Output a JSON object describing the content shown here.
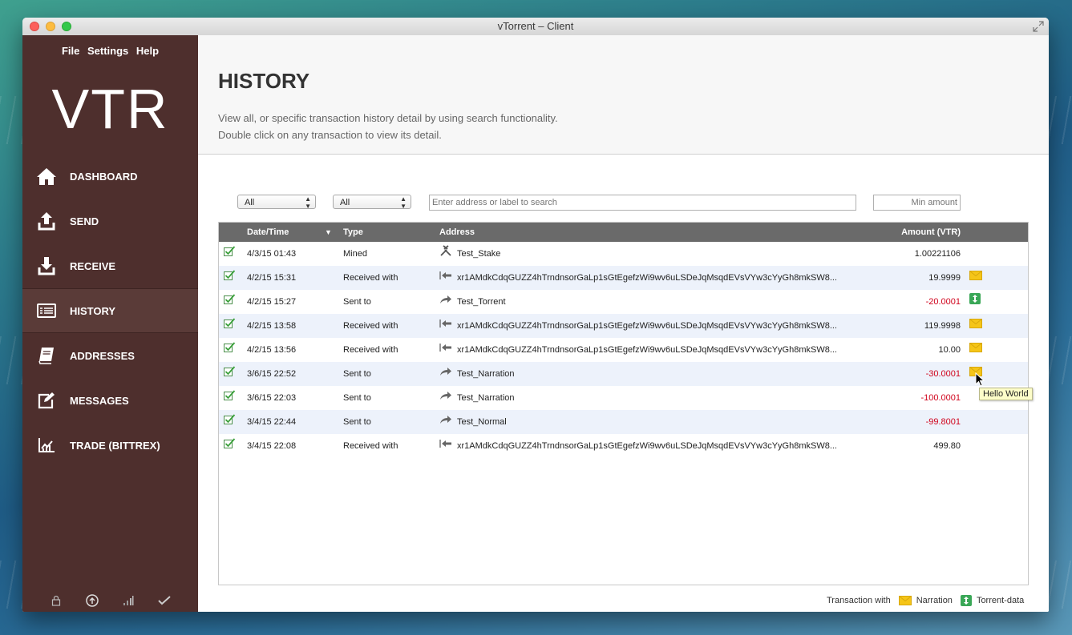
{
  "window": {
    "title": "vTorrent – Client"
  },
  "sidebar": {
    "menu": [
      "File",
      "Settings",
      "Help"
    ],
    "logo": "VTR",
    "nav": [
      {
        "label": "DASHBOARD",
        "icon": "home-icon"
      },
      {
        "label": "SEND",
        "icon": "upload-icon"
      },
      {
        "label": "RECEIVE",
        "icon": "download-icon"
      },
      {
        "label": "HISTORY",
        "icon": "list-icon",
        "active": true
      },
      {
        "label": "ADDRESSES",
        "icon": "book-icon"
      },
      {
        "label": "MESSAGES",
        "icon": "compose-icon"
      },
      {
        "label": "TRADE (BITTREX)",
        "icon": "chart-icon"
      }
    ],
    "footer_icons": [
      "lock-icon",
      "arrow-up-circle-icon",
      "signal-bars-icon",
      "checkmark-icon"
    ]
  },
  "header": {
    "title": "HISTORY",
    "line1": "View all, or specific transaction history detail by using search functionality.",
    "line2": "Double click on any transaction to view its detail."
  },
  "filters": {
    "date_filter": "All",
    "type_filter": "All",
    "search_placeholder": "Enter address or label to search",
    "min_amount_placeholder": "Min amount"
  },
  "table": {
    "columns": {
      "date": "Date/Time",
      "type": "Type",
      "address": "Address",
      "amount": "Amount (VTR)"
    },
    "rows": [
      {
        "date": "4/3/15 01:43",
        "type": "Mined",
        "address": "Test_Stake",
        "addr_icon": "mined-icon",
        "amount": "1.00221106",
        "negative": false,
        "extra": ""
      },
      {
        "date": "4/2/15 15:31",
        "type": "Received with",
        "address": "xr1AMdkCdqGUZZ4hTrndnsorGaLp1sGtEgefzWi9wv6uLSDeJqMsqdEVsVYw3cYyGh8mkSW8...",
        "addr_icon": "receive-arrow-icon",
        "amount": "19.9999",
        "negative": false,
        "extra": "envelope-icon"
      },
      {
        "date": "4/2/15 15:27",
        "type": "Sent to",
        "address": "Test_Torrent",
        "addr_icon": "send-arrow-icon",
        "amount": "-20.0001",
        "negative": true,
        "extra": "torrent-icon"
      },
      {
        "date": "4/2/15 13:58",
        "type": "Received with",
        "address": "xr1AMdkCdqGUZZ4hTrndnsorGaLp1sGtEgefzWi9wv6uLSDeJqMsqdEVsVYw3cYyGh8mkSW8...",
        "addr_icon": "receive-arrow-icon",
        "amount": "119.9998",
        "negative": false,
        "extra": "envelope-icon"
      },
      {
        "date": "4/2/15 13:56",
        "type": "Received with",
        "address": "xr1AMdkCdqGUZZ4hTrndnsorGaLp1sGtEgefzWi9wv6uLSDeJqMsqdEVsVYw3cYyGh8mkSW8...",
        "addr_icon": "receive-arrow-icon",
        "amount": "10.00",
        "negative": false,
        "extra": "envelope-icon"
      },
      {
        "date": "3/6/15 22:52",
        "type": "Sent to",
        "address": "Test_Narration",
        "addr_icon": "send-arrow-icon",
        "amount": "-30.0001",
        "negative": true,
        "extra": "envelope-icon"
      },
      {
        "date": "3/6/15 22:03",
        "type": "Sent to",
        "address": "Test_Narration",
        "addr_icon": "send-arrow-icon",
        "amount": "-100.0001",
        "negative": true,
        "extra": ""
      },
      {
        "date": "3/4/15 22:44",
        "type": "Sent to",
        "address": "Test_Normal",
        "addr_icon": "send-arrow-icon",
        "amount": "-99.8001",
        "negative": true,
        "extra": ""
      },
      {
        "date": "3/4/15 22:08",
        "type": "Received with",
        "address": "xr1AMdkCdqGUZZ4hTrndnsorGaLp1sGtEgefzWi9wv6uLSDeJqMsqdEVsVYw3cYyGh8mkSW8...",
        "addr_icon": "receive-arrow-icon",
        "amount": "499.80",
        "negative": false,
        "extra": ""
      }
    ]
  },
  "tooltip": {
    "text": "Hello World"
  },
  "legend": {
    "prefix": "Transaction with",
    "narration": "Narration",
    "torrent": "Torrent-data"
  },
  "colors": {
    "sidebar": "#4e2f2d",
    "negative": "#d0021b",
    "envelope": "#f5c518",
    "torrent": "#3aa757",
    "table_header": "#6a6a6a"
  }
}
